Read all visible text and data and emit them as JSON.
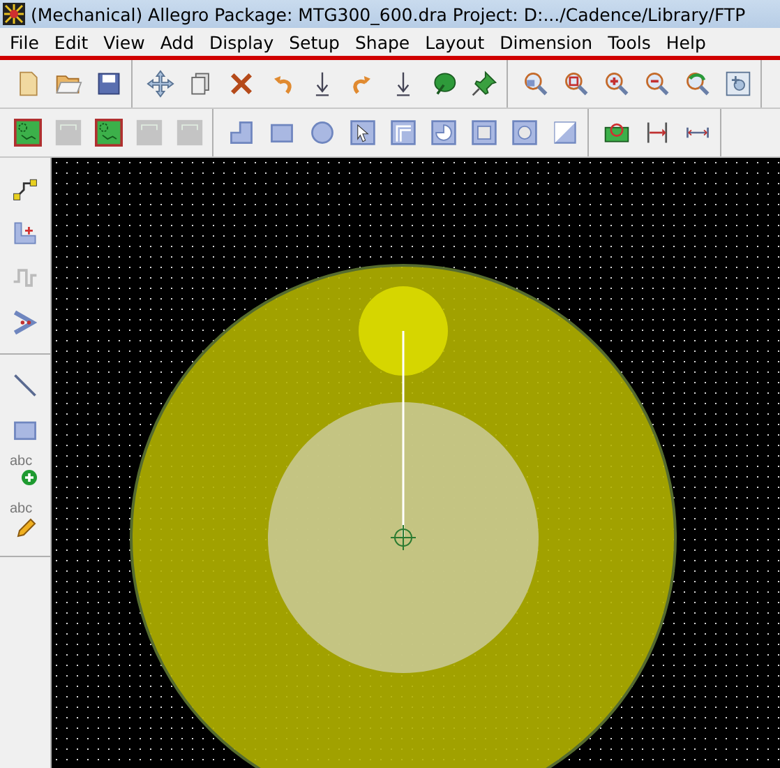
{
  "window": {
    "title": "(Mechanical) Allegro Package: MTG300_600.dra  Project: D:.../Cadence/Library/FTP"
  },
  "menu": [
    {
      "label": "File"
    },
    {
      "label": "Edit"
    },
    {
      "label": "View"
    },
    {
      "label": "Add"
    },
    {
      "label": "Display"
    },
    {
      "label": "Setup"
    },
    {
      "label": "Shape"
    },
    {
      "label": "Layout"
    },
    {
      "label": "Dimension"
    },
    {
      "label": "Tools"
    },
    {
      "label": "Help"
    }
  ],
  "toolbar_rows": [
    [
      [
        {
          "kind": "new",
          "disabled": false
        },
        {
          "kind": "open",
          "disabled": false
        },
        {
          "kind": "save",
          "disabled": false
        }
      ],
      [
        {
          "kind": "move",
          "disabled": false
        },
        {
          "kind": "copy",
          "disabled": false
        },
        {
          "kind": "delete",
          "disabled": false
        },
        {
          "kind": "undo",
          "disabled": false
        },
        {
          "kind": "down",
          "disabled": false
        },
        {
          "kind": "redo",
          "disabled": false
        },
        {
          "kind": "down",
          "disabled": false
        },
        {
          "kind": "leaf",
          "disabled": false
        },
        {
          "kind": "pin",
          "disabled": false
        }
      ],
      [
        {
          "kind": "zoompoint",
          "disabled": false
        },
        {
          "kind": "zoomfit",
          "disabled": false
        },
        {
          "kind": "zoomin",
          "disabled": false
        },
        {
          "kind": "zoomout",
          "disabled": false
        },
        {
          "kind": "zoomprev",
          "disabled": false
        },
        {
          "kind": "zoomworld",
          "disabled": false
        }
      ]
    ],
    [
      [
        {
          "kind": "board",
          "disabled": false
        },
        {
          "kind": "outline",
          "disabled": true
        },
        {
          "kind": "board",
          "disabled": false
        },
        {
          "kind": "outline",
          "disabled": true
        },
        {
          "kind": "outline",
          "disabled": true
        }
      ],
      [
        {
          "kind": "lshape",
          "disabled": false
        },
        {
          "kind": "rect",
          "disabled": false
        },
        {
          "kind": "circle",
          "disabled": false
        },
        {
          "kind": "select",
          "disabled": false
        },
        {
          "kind": "void",
          "disabled": false
        },
        {
          "kind": "voidcircle",
          "disabled": false
        },
        {
          "kind": "square",
          "disabled": false
        },
        {
          "kind": "ring",
          "disabled": false
        },
        {
          "kind": "merge",
          "disabled": false
        }
      ],
      [
        {
          "kind": "chip",
          "disabled": false
        },
        {
          "kind": "dimarrow",
          "disabled": false
        },
        {
          "kind": "dimline",
          "disabled": false
        }
      ]
    ]
  ],
  "side_tools": [
    [
      {
        "kind": "route",
        "disabled": false
      },
      {
        "kind": "keepin",
        "disabled": false
      },
      {
        "kind": "wave",
        "disabled": true
      },
      {
        "kind": "chevron",
        "disabled": false
      }
    ],
    [
      {
        "kind": "line",
        "disabled": false
      },
      {
        "kind": "rect",
        "disabled": false
      },
      {
        "kind": "addtext",
        "glyph": "abc",
        "disabled": false
      },
      {
        "kind": "edittext",
        "glyph": "abc",
        "disabled": false
      }
    ]
  ]
}
